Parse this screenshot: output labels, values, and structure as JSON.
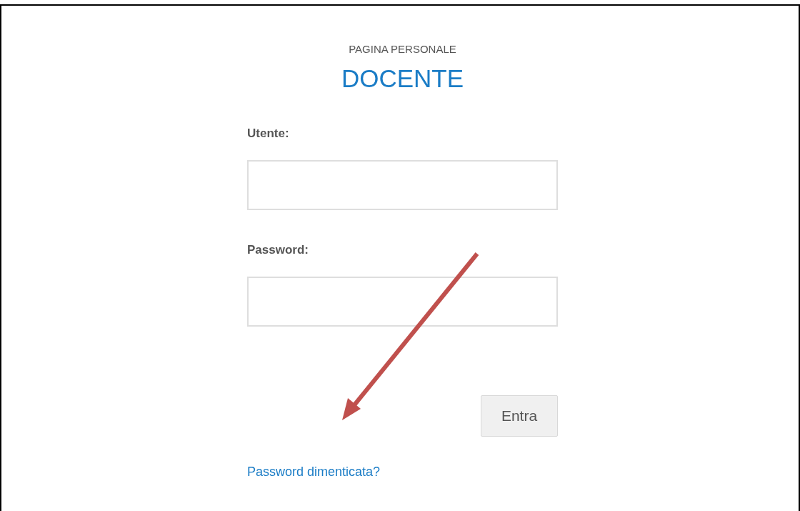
{
  "header": {
    "subtitle": "PAGINA PERSONALE",
    "title": "DOCENTE"
  },
  "fields": [
    {
      "label": "Utente:"
    },
    {
      "label": "Password:"
    }
  ],
  "submit_button": "Entra",
  "forgot_link": "Password dimenticata?"
}
